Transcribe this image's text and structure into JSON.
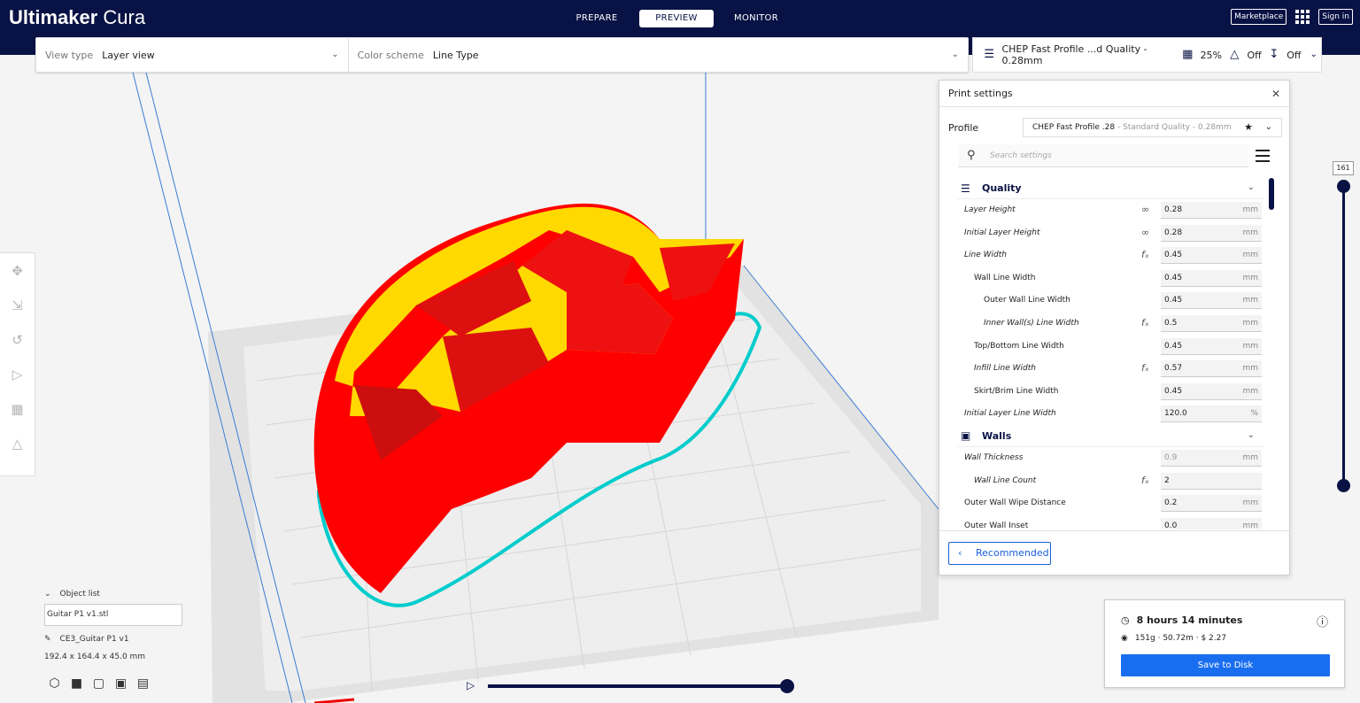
{
  "app": {
    "brand_bold": "Ultimaker",
    "brand_light": " Cura"
  },
  "stages": [
    {
      "label": "PREPARE",
      "active": false
    },
    {
      "label": "PREVIEW",
      "active": true
    },
    {
      "label": "MONITOR",
      "active": false
    }
  ],
  "top_right": {
    "marketplace": "Marketplace",
    "signin": "Sign in"
  },
  "toolbar": {
    "view_type_label": "View type",
    "view_type_value": "Layer view",
    "color_scheme_label": "Color scheme",
    "color_scheme_value": "Line Type"
  },
  "quick_settings": {
    "profile": "CHEP Fast Profile ...d Quality - 0.28mm",
    "infill": "25%",
    "support": "Off",
    "adhesion": "Off"
  },
  "print_settings": {
    "title": "Print settings",
    "profile_label": "Profile",
    "profile_name": "CHEP Fast Profile .28",
    "profile_suffix": " - Standard Quality - 0.28mm",
    "search_placeholder": "Search settings",
    "categories": [
      {
        "name": "Quality",
        "rows": [
          {
            "label": "Layer Height",
            "indent": 0,
            "italic": true,
            "icon": "link",
            "value": "0.28",
            "unit": "mm",
            "disabled": false
          },
          {
            "label": "Initial Layer Height",
            "indent": 0,
            "italic": true,
            "icon": "link",
            "value": "0.28",
            "unit": "mm",
            "disabled": false
          },
          {
            "label": "Line Width",
            "indent": 0,
            "italic": true,
            "icon": "fx",
            "value": "0.45",
            "unit": "mm",
            "disabled": false
          },
          {
            "label": "Wall Line Width",
            "indent": 1,
            "italic": false,
            "icon": "",
            "value": "0.45",
            "unit": "mm",
            "disabled": false
          },
          {
            "label": "Outer Wall Line Width",
            "indent": 2,
            "italic": false,
            "icon": "",
            "value": "0.45",
            "unit": "mm",
            "disabled": false
          },
          {
            "label": "Inner Wall(s) Line Width",
            "indent": 2,
            "italic": true,
            "icon": "fx",
            "value": "0.5",
            "unit": "mm",
            "disabled": false
          },
          {
            "label": "Top/Bottom Line Width",
            "indent": 1,
            "italic": false,
            "icon": "",
            "value": "0.45",
            "unit": "mm",
            "disabled": false
          },
          {
            "label": "Infill Line Width",
            "indent": 1,
            "italic": true,
            "icon": "fx",
            "value": "0.57",
            "unit": "mm",
            "disabled": false
          },
          {
            "label": "Skirt/Brim Line Width",
            "indent": 1,
            "italic": false,
            "icon": "",
            "value": "0.45",
            "unit": "mm",
            "disabled": false
          },
          {
            "label": "Initial Layer Line Width",
            "indent": 0,
            "italic": true,
            "icon": "",
            "value": "120.0",
            "unit": "%",
            "disabled": false
          }
        ]
      },
      {
        "name": "Walls",
        "rows": [
          {
            "label": "Wall Thickness",
            "indent": 0,
            "italic": true,
            "icon": "",
            "value": "0.9",
            "unit": "mm",
            "disabled": true
          },
          {
            "label": "Wall Line Count",
            "indent": 1,
            "italic": true,
            "icon": "fx",
            "value": "2",
            "unit": "",
            "disabled": false
          },
          {
            "label": "Outer Wall Wipe Distance",
            "indent": 0,
            "italic": false,
            "icon": "",
            "value": "0.2",
            "unit": "mm",
            "disabled": false
          },
          {
            "label": "Outer Wall Inset",
            "indent": 0,
            "italic": false,
            "icon": "",
            "value": "0.0",
            "unit": "mm",
            "disabled": false
          }
        ]
      }
    ],
    "recommended_label": "Recommended"
  },
  "layer_slider": {
    "current": "161",
    "level_fraction": 1.0
  },
  "object_list": {
    "header": "Object list",
    "file": "Guitar P1 v1.stl",
    "object_name": "CE3_Guitar P1 v1",
    "dimensions": "192.4 x 164.4 x 45.0 mm"
  },
  "simulation": {
    "progress_fraction": 1.0
  },
  "print_info": {
    "time": "8 hours 14 minutes",
    "material": "151g · 50.72m · $ 2.27",
    "save_label": "Save to Disk"
  },
  "colors": {
    "header": "#081244",
    "accent": "#196ef0",
    "wall": "#ff0000",
    "infill": "#ffff00",
    "skirt": "#00ffff"
  }
}
